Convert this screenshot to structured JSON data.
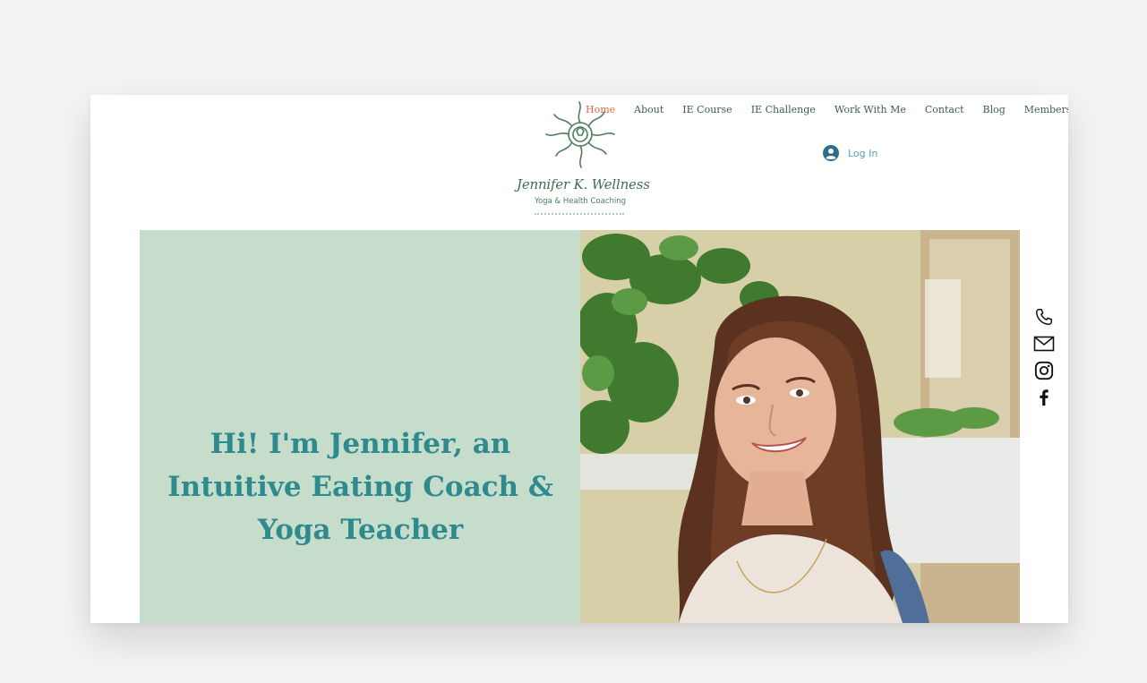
{
  "brand": {
    "name": "Jennifer K. Wellness",
    "tagline": "Yoga & Health Coaching"
  },
  "nav": {
    "items": [
      "Home",
      "About",
      "IE Course",
      "IE Challenge",
      "Work With Me",
      "Contact",
      "Blog",
      "Members"
    ],
    "active": "Home"
  },
  "login": {
    "label": "Log In",
    "icon": "user-avatar-icon"
  },
  "hero": {
    "title": "Hi! I'm Jennifer, an Intuitive Eating Coach & Yoga Teacher",
    "photo_alt": "Portrait photo of Jennifer smiling outdoors"
  },
  "social": {
    "icons": [
      "phone-icon",
      "mail-icon",
      "instagram-icon",
      "facebook-icon"
    ]
  },
  "colors": {
    "accent_active": "#e5643e",
    "nav_text": "#3e5f47",
    "hero_panel": "#c7ddcc",
    "hero_title": "#2e8a8c",
    "login_text": "#4fa6a8"
  }
}
